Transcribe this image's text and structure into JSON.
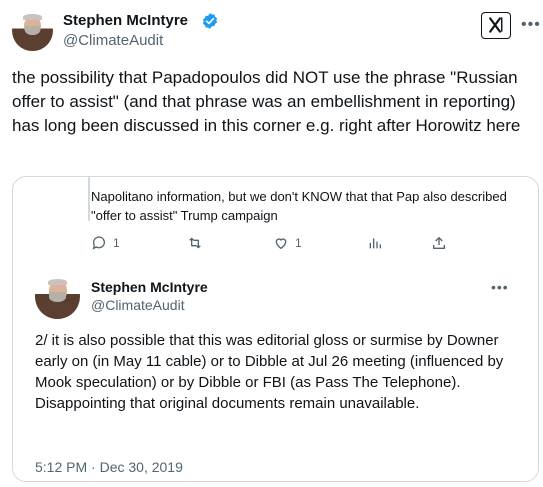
{
  "author": {
    "name": "Stephen McIntyre",
    "handle": "@ClimateAudit"
  },
  "logo": "x-logo",
  "more_icon": "more-horizontal-icon",
  "tweet": {
    "text": "the possibility that Papadopoulos did NOT use the phrase \"Russian offer to assist\" (and that phrase was an embellishment in reporting) has long been discussed in this corner e.g. right after Horowitz here"
  },
  "quoted_thread": {
    "previous_text": "Napolitano information, but we don't KNOW that that Pap also described \"offer to assist\" Trump campaign",
    "actions": {
      "reply_count": "1",
      "retweet_count": "",
      "like_count": "1"
    },
    "reply": {
      "name": "Stephen McIntyre",
      "handle": "@ClimateAudit",
      "text": "2/ it is also possible that this was editorial gloss or surmise by Downer early on (in May 11 cable) or to Dibble at Jul 26 meeting (influenced by Mook speculation) or by Dibble or FBI (as Pass The Telephone). Disappointing that original documents remain unavailable.",
      "timestamp": "5:12 PM · Dec 30, 2019"
    }
  },
  "colors": {
    "verified": "#1d9bf0",
    "secondary_text": "#536471",
    "border": "#cfd9de"
  }
}
